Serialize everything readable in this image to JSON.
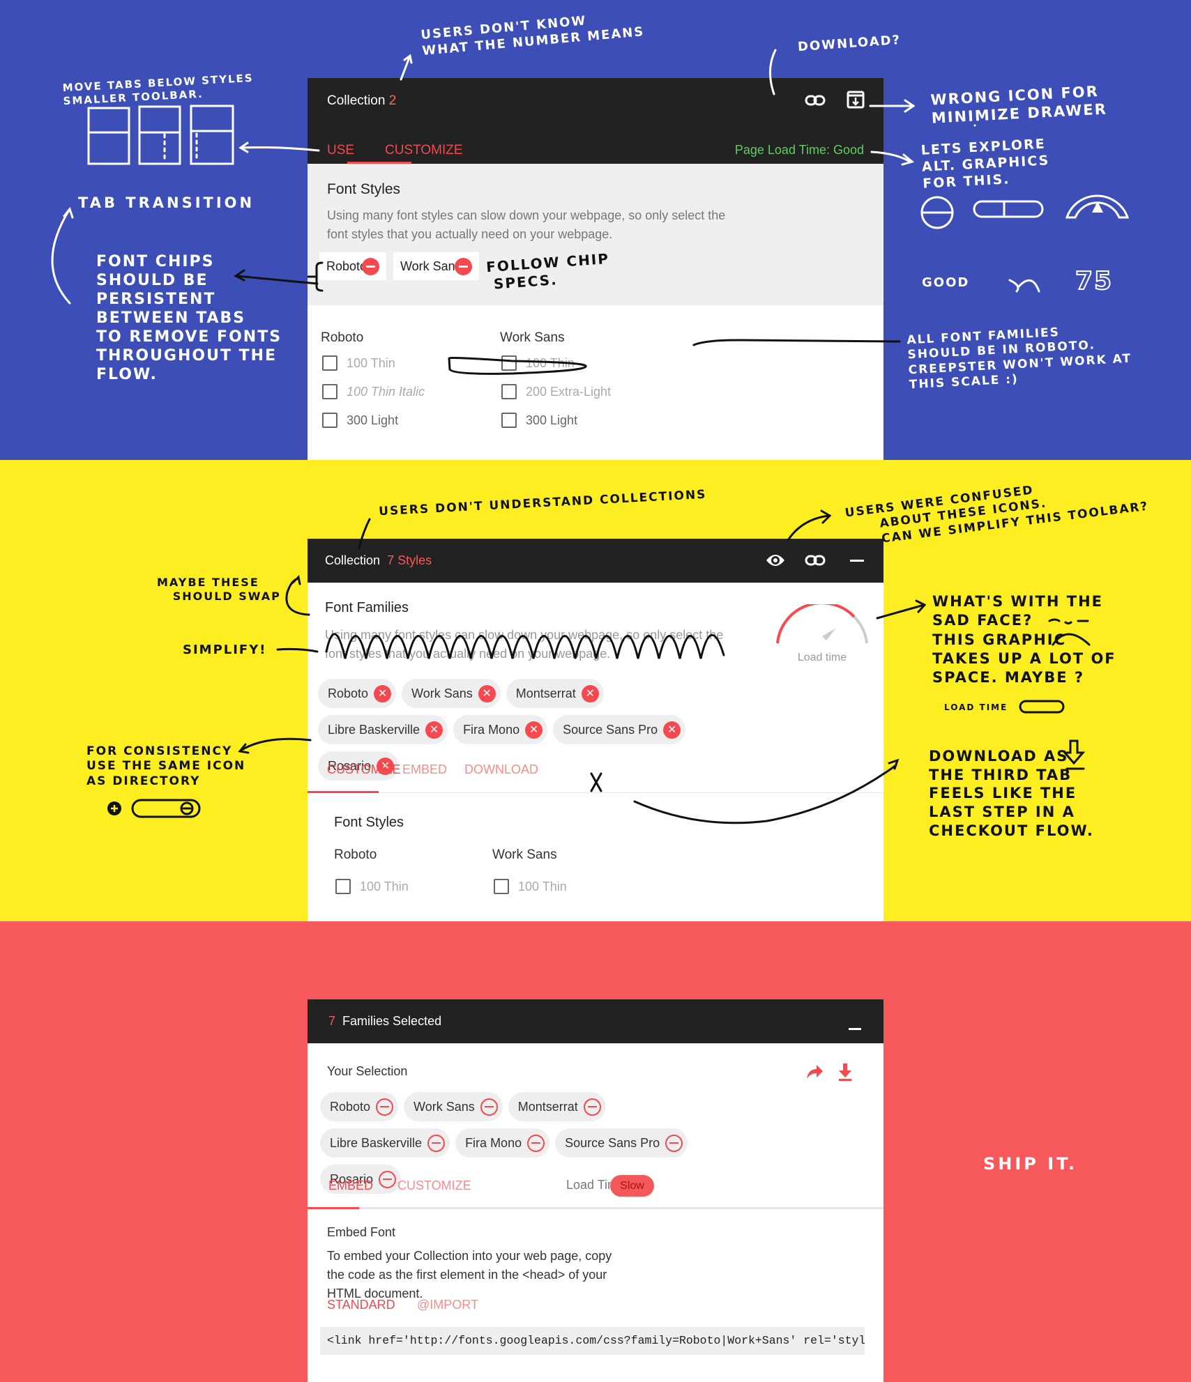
{
  "colors": {
    "blue": "#3d4fb6",
    "yellow": "#fcee21",
    "red": "#f7585b",
    "accent": "#f5484f",
    "good": "#5bd15b",
    "header": "#222222"
  },
  "panel1": {
    "title": "Collection",
    "count": "2",
    "tabs": [
      "USE",
      "CUSTOMIZE"
    ],
    "active_tab": "CUSTOMIZE",
    "status": "Page Load Time: Good",
    "icons": [
      "link-icon",
      "minimize-drawer-icon"
    ],
    "section_title": "Font Styles",
    "description": "Using many font styles can slow down your webpage, so only select the font styles that you actually need on your webpage.",
    "chips": [
      "Roboto",
      "Work Sans"
    ],
    "families": [
      {
        "name": "Roboto",
        "styles": [
          "100 Thin",
          "100 Thin Italic",
          "300 Light"
        ]
      },
      {
        "name": "Work Sans",
        "styles": [
          "100 Thin",
          "200 Extra-Light",
          "300 Light"
        ]
      }
    ]
  },
  "panel2": {
    "title": "Collection",
    "count": "7 Styles",
    "icons": [
      "eye-icon",
      "link-icon",
      "minimize-icon"
    ],
    "section_title": "Font Families",
    "description": "Using many font styles can slow down your webpage, so only select the font styles that you actually need on your webpage.",
    "gauge_label": "Load time",
    "chips": [
      "Roboto",
      "Work Sans",
      "Montserrat",
      "Libre Baskerville",
      "Fira Mono",
      "Source Sans Pro",
      "Rosario"
    ],
    "tabs": [
      "CUSTOMIZE",
      "EMBED",
      "DOWNLOAD"
    ],
    "active_tab": "CUSTOMIZE",
    "styles_title": "Font Styles",
    "families": [
      {
        "name": "Roboto",
        "styles": [
          "100 Thin"
        ]
      },
      {
        "name": "Work Sans",
        "styles": [
          "100 Thin"
        ]
      }
    ]
  },
  "panel3": {
    "count": "7",
    "title": "Families Selected",
    "selection_title": "Your Selection",
    "icons": [
      "share-icon",
      "download-icon",
      "minimize-icon"
    ],
    "chips": [
      "Roboto",
      "Work Sans",
      "Montserrat",
      "Libre Baskerville",
      "Fira Mono",
      "Source Sans Pro",
      "Rosario"
    ],
    "tabs": [
      "EMBED",
      "CUSTOMIZE"
    ],
    "active_tab": "EMBED",
    "load_time_label": "Load Time",
    "load_time_value": "Slow",
    "embed_title": "Embed Font",
    "embed_desc": "To embed your Collection into your web page, copy the code as the first element in the <head> of your HTML document.",
    "embed_tabs": [
      "STANDARD",
      "@IMPORT"
    ],
    "code": "<link href='http://fonts.googleapis.com/css?family=Roboto|Work+Sans' rel='styleshe"
  },
  "notes": {
    "number": "USERS DON'T KNOW\nWHAT THE NUMBER MEANS",
    "download": "DOWNLOAD?",
    "move_tabs": "MOVE TABS BELOW STYLES\nSMALLER TOOLBAR.",
    "tab_transition": "TAB TRANSITION",
    "font_chips": "FONT CHIPS\nSHOULD BE\nPERSISTENT\nBETWEEN TABS\nTO REMOVE FONTS\nTHROUGHOUT THE\nFLOW.",
    "follow_chip": "FOLLOW CHIP\n SPECS.",
    "wrong_icon": "WRONG ICON FOR\nMINIMIZE DRAWER",
    "explore": "LETS EXPLORE\nALT. GRAPHICS\nFOR THIS.",
    "good": "GOOD",
    "seventy_five": "75",
    "roboto": "ALL FONT FAMILIES\nSHOULD BE IN ROBOTO.\nCREEPSTER WON'T WORK AT\nTHIS SCALE :)",
    "collections": "USERS DON'T UNDERSTAND COLLECTIONS",
    "confused": "USERS WERE CONFUSED\n      ABOUT THESE ICONS.\n      CAN WE SIMPLIFY THIS TOOLBAR?",
    "swap": "MAYBE THESE\n   SHOULD SWAP",
    "simplify": "SIMPLIFY!",
    "sad_face": "WHAT'S WITH THE\nSAD FACE?\nTHIS GRAPHIC\nTAKES UP A LOT OF\nSPACE. MAYBE ?",
    "load_time": "LOAD TIME",
    "download_tab": "DOWNLOAD AS\nTHE THIRD TAB\nFEELS LIKE THE\nLAST STEP IN A\nCHECKOUT FLOW.",
    "consistency": "FOR CONSISTENCY\nUSE THE SAME ICON\nAS DIRECTORY",
    "ship": "SHIP IT."
  }
}
